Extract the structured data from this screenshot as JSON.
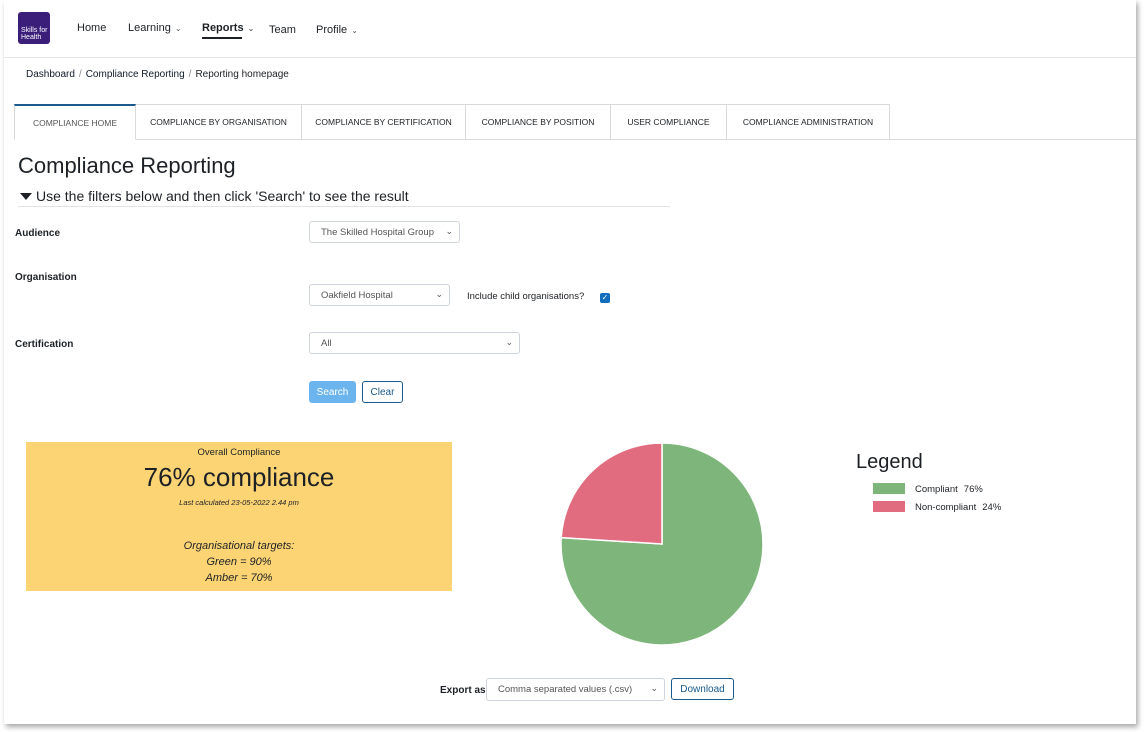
{
  "brand": {
    "logo_text_1": "Skills for",
    "logo_text_2": "Health"
  },
  "nav": {
    "home": "Home",
    "learning": "Learning",
    "reports": "Reports",
    "team": "Team",
    "profile": "Profile",
    "chevron": "⌄"
  },
  "breadcrumb": [
    "Dashboard",
    "Compliance Reporting",
    "Reporting homepage"
  ],
  "tabs": [
    "COMPLIANCE HOME",
    "COMPLIANCE BY ORGANISATION",
    "COMPLIANCE BY CERTIFICATION",
    "COMPLIANCE BY POSITION",
    "USER COMPLIANCE",
    "COMPLIANCE ADMINISTRATION"
  ],
  "page_title": "Compliance Reporting",
  "filters_toggle": "Use the filters below and then click 'Search' to see the result",
  "filters": {
    "audience_label": "Audience",
    "audience_value": "The Skilled Hospital Group",
    "organisation_label": "Organisation",
    "organisation_value": "Oakfield Hospital",
    "include_child_label": "Include child organisations?",
    "include_child_checked": true,
    "certification_label": "Certification",
    "certification_value": "All"
  },
  "buttons": {
    "search": "Search",
    "clear": "Clear",
    "download": "Download"
  },
  "summary": {
    "title": "Overall Compliance",
    "big": "76% compliance",
    "calculated": "Last calculated 23-05-2022 2.44 pm",
    "targets_heading": "Organisational targets:",
    "green": "Green = 90%",
    "amber": "Amber = 70%",
    "bg_color": "#fdd474"
  },
  "chart_data": {
    "type": "pie",
    "categories": [
      "Compliant",
      "Non-compliant"
    ],
    "values": [
      76,
      24
    ],
    "colors": [
      "#7db57a",
      "#e16c7f"
    ]
  },
  "legend": {
    "title": "Legend",
    "items": [
      {
        "label": "Compliant",
        "pct": "76%"
      },
      {
        "label": "Non-compliant",
        "pct": "24%"
      }
    ]
  },
  "export": {
    "label": "Export as",
    "value": "Comma separated values (.csv)"
  }
}
